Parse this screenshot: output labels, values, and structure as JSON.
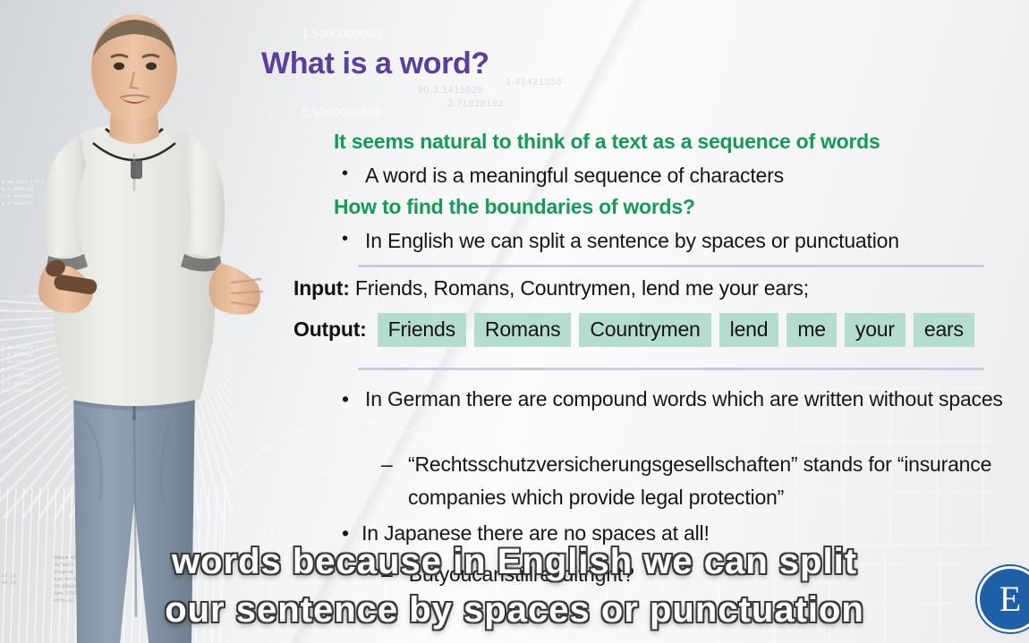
{
  "slide": {
    "title": "What is a word?",
    "heading_1": "It seems natural to think of a text as a sequence of words",
    "bullet_word": "A word is a meaningful sequence of characters",
    "heading_2": "How to find the boundaries of words?",
    "bullet_split": "In English we can split a sentence by spaces or punctuation",
    "io": {
      "input_label": "Input:",
      "input_value": "Friends, Romans, Countrymen, lend me your ears;",
      "output_label": "Output:",
      "output_tokens": [
        "Friends",
        "Romans",
        "Countrymen",
        "lend",
        "me",
        "your",
        "ears"
      ]
    },
    "bullet_german": "In German there are compound words which are written without spaces",
    "dash_german": "“Rechtsschutzversicherungsgesellschaften” stands for “insurance companies which provide legal protection”",
    "bullet_japanese": "In Japanese there are no spaces at all!",
    "dash_japanese": "Butyoucanstillreaditright?",
    "bullet_glyph": "•",
    "dash_glyph": "–",
    "background_numbers": {
      "n1": "1.5000000000",
      "n2": "0.5000000000",
      "n3": "90,3.1415926",
      "n4": "2.71828182",
      "n5": "1.41421356"
    },
    "blueprint_text": {
      "a": "0.44 1008 F°C 1\nK 2.0891128\nL 0.9430015\nE 4.0021137",
      "b": "K 40.018875 1\nL 0.8879012\nF 74.2211 0\nE 0.4420013\nR 7.7740122\nA 2.0018844\nD 1.0220037",
      "c": "EDmum RPM\n3a°mult 0.4\nOtuprom 40-Xx\nAxH-6U-b4%\n76,559316 RDeRouer°eHo\n104.72575\nnhYa-EF multi",
      "d": "23 11\n04 21"
    },
    "logo_letter": "E"
  },
  "caption": {
    "line_1": "words because in English we can split",
    "line_2": "our sentence by spaces or punctuation"
  },
  "colors": {
    "title_purple": "#5a3f9d",
    "heading_green": "#169a57",
    "token_mint": "#b5ddcf",
    "rule_lavender": "#cdc9de",
    "logo_blue": "#1f5fa8"
  }
}
